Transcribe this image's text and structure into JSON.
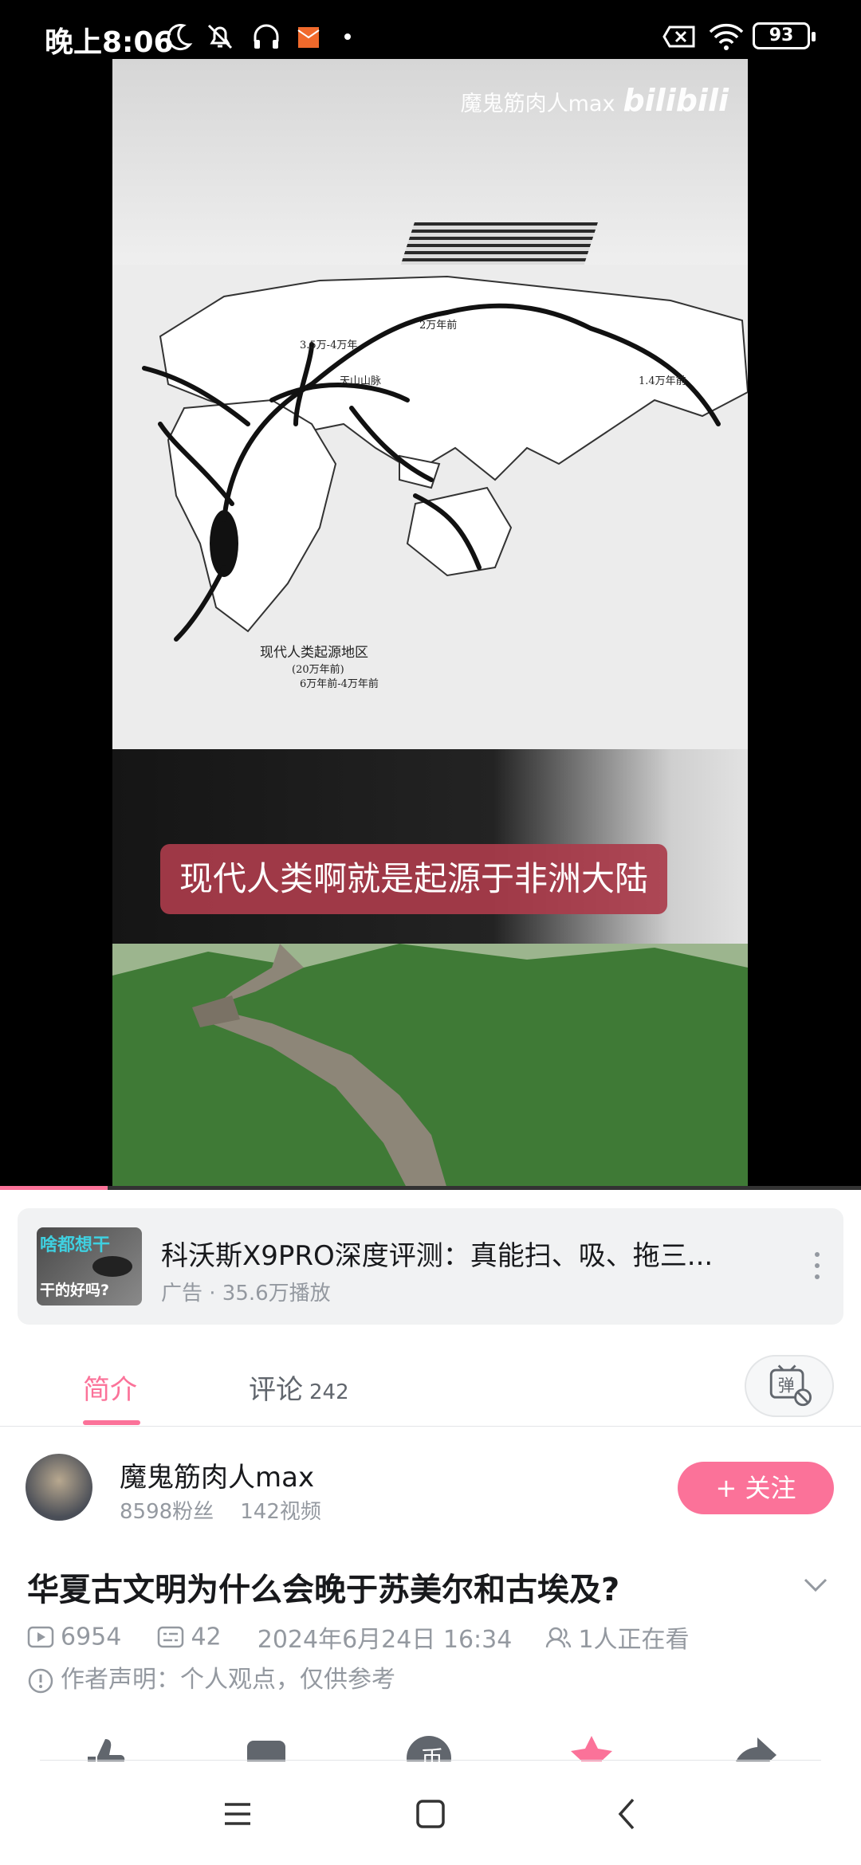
{
  "status_bar": {
    "time": "晚上8:06",
    "battery": "93",
    "icons": [
      "moon-icon",
      "mute-icon",
      "headphones-icon",
      "mail-icon",
      "dot-icon",
      "sim-off-icon",
      "wifi-icon",
      "battery-icon"
    ]
  },
  "video": {
    "watermark_channel": "魔鬼筋肉人max",
    "watermark_brand": "bilibili",
    "subtitle": "现代人类啊就是起源于非洲大陆",
    "map_labels": [
      "2万年前",
      "3.5万-4万年",
      "1.4万年前",
      "天山山脉",
      "现代人类起源地区",
      "(20万年前)",
      "6万年前-4万年前"
    ],
    "progress": 0.125
  },
  "ad": {
    "thumb_text_1": "啥都想干",
    "thumb_text_2": "干的好吗?",
    "title": "科沃斯X9PRO深度评测：真能扫、吸、拖三...",
    "meta": "广告 · 35.6万播放"
  },
  "tabs": {
    "intro": "简介",
    "comments": "评论",
    "comments_count": "242",
    "danmaku_label": "弹"
  },
  "uploader": {
    "name": "魔鬼筋肉人max",
    "fans": "8598粉丝",
    "videos": "142视频",
    "follow_label": "+ 关注"
  },
  "video_info": {
    "title": "华夏古文明为什么会晚于苏美尔和古埃及?",
    "plays": "6954",
    "danmaku": "42",
    "date": "2024年6月24日 16:34",
    "watching": "1人正在看",
    "declaration": "作者声明：个人观点，仅供参考"
  },
  "colors": {
    "accent": "#fb7299",
    "muted": "#9499a0",
    "text": "#18191c"
  }
}
